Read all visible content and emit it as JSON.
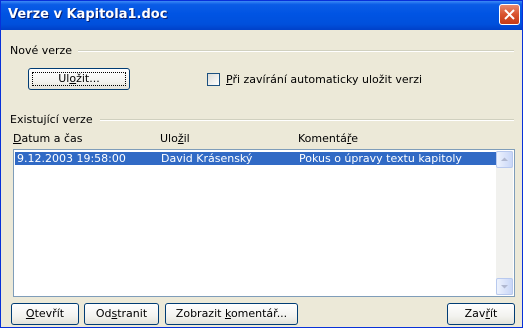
{
  "title": "Verze v Kapitola1.doc",
  "new_versions": {
    "group_label": "Nové verze",
    "save_button": {
      "pre": "Ul",
      "u": "o",
      "post": "žit..."
    },
    "auto_save_checkbox": {
      "checked": false,
      "pre": "",
      "u": "P",
      "post": "ři zavírání automaticky uložit verzi"
    }
  },
  "existing_versions": {
    "group_label": "Existující verze",
    "columns": [
      {
        "pre": "",
        "u": "D",
        "post": "atum a čas"
      },
      {
        "pre": "Ulo",
        "u": "ž",
        "post": "il"
      },
      {
        "pre": "Komentá",
        "u": "ř",
        "post": "e"
      }
    ],
    "rows": [
      {
        "date": "9.12.2003 19:58:00",
        "author": "David Krásenský",
        "comment": "Pokus o úpravy textu kapitoly",
        "selected": true
      }
    ]
  },
  "buttons": {
    "open": {
      "pre": "",
      "u": "O",
      "post": "tevřít"
    },
    "delete": {
      "pre": "Od",
      "u": "s",
      "post": "tranit"
    },
    "show_comment": {
      "pre": "Zobrazit ",
      "u": "k",
      "post": "omentář..."
    },
    "close": {
      "pre": "Zav",
      "u": "ř",
      "post": "ít"
    }
  }
}
